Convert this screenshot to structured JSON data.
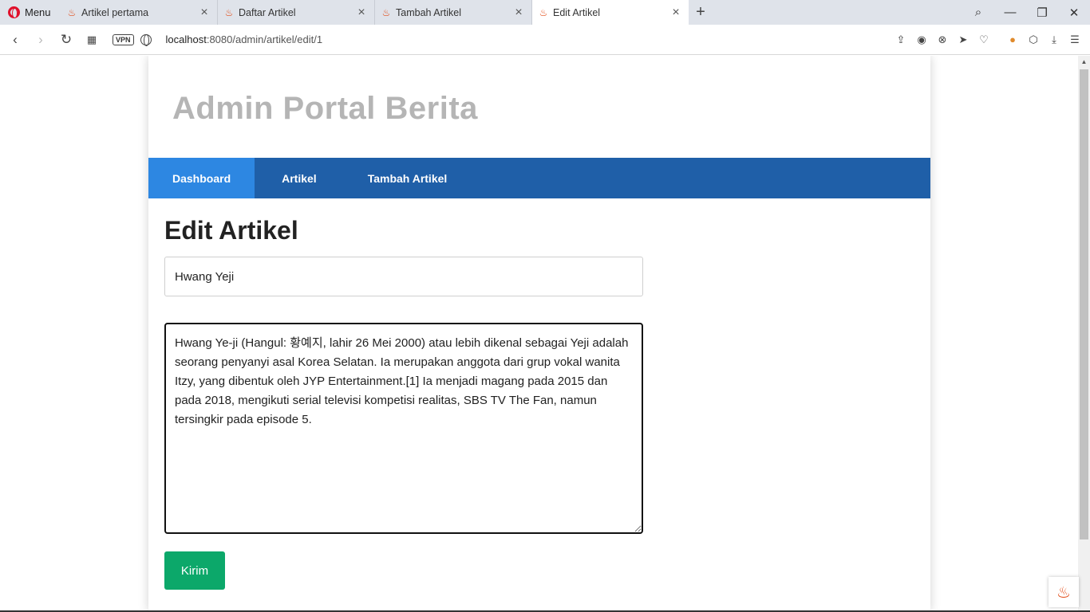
{
  "browser": {
    "menu_label": "Menu",
    "tabs": [
      {
        "title": "Artikel pertama",
        "icon": "fire-icon"
      },
      {
        "title": "Daftar Artikel",
        "icon": "fire-icon"
      },
      {
        "title": "Tambah Artikel",
        "icon": "fire-icon"
      },
      {
        "title": "Edit Artikel",
        "icon": "fire-icon",
        "active": true
      }
    ],
    "url_host": "localhost",
    "url_rest": ":8080/admin/artikel/edit/1",
    "vpn_label": "VPN"
  },
  "site": {
    "title": "Admin Portal Berita",
    "nav": [
      {
        "label": "Dashboard",
        "active": true
      },
      {
        "label": "Artikel"
      },
      {
        "label": "Tambah Artikel"
      }
    ]
  },
  "form": {
    "heading": "Edit Artikel",
    "title_value": "Hwang Yeji",
    "body_value": "Hwang Ye-ji (Hangul: 황예지, lahir 26 Mei 2000) atau lebih dikenal sebagai Yeji adalah seorang penyanyi asal Korea Selatan. Ia merupakan anggota dari grup vokal wanita Itzy, yang dibentuk oleh JYP Entertainment.[1] Ia menjadi magang pada 2015 dan pada 2018, mengikuti serial televisi kompetisi realitas, SBS TV The Fan, namun tersingkir pada episode 5.",
    "submit_label": "Kirim"
  },
  "colors": {
    "nav_bg": "#1f5fa8",
    "nav_active": "#2d87e2",
    "submit_bg": "#0ca86a",
    "site_title": "#b5b5b5"
  }
}
